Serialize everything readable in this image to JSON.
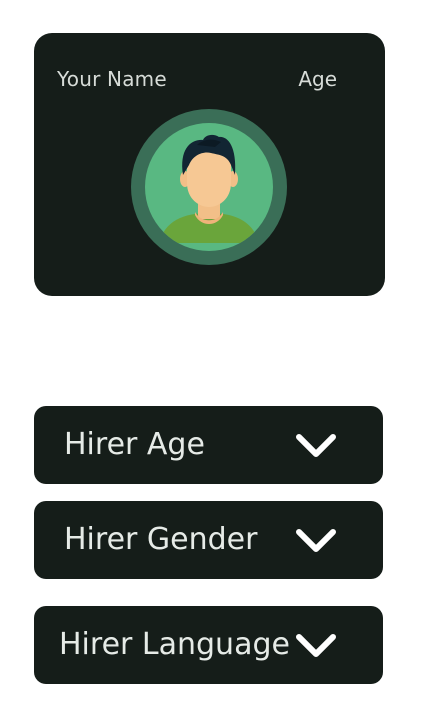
{
  "profile": {
    "name_label": "Your Name",
    "age_label": "Age",
    "avatar_icon": "user-avatar-icon",
    "colors": {
      "card_bg": "#151d19",
      "ring": "#3a6e57",
      "circle": "#59b882",
      "shirt": "#6aa53b",
      "skin": "#f6c894",
      "hair": "#122533"
    }
  },
  "filters": [
    {
      "label": "Hirer Age",
      "icon": "chevron-down-icon"
    },
    {
      "label": "Hirer Gender",
      "icon": "chevron-down-icon"
    },
    {
      "label": "Hirer Language",
      "icon": "chevron-down-icon"
    }
  ]
}
